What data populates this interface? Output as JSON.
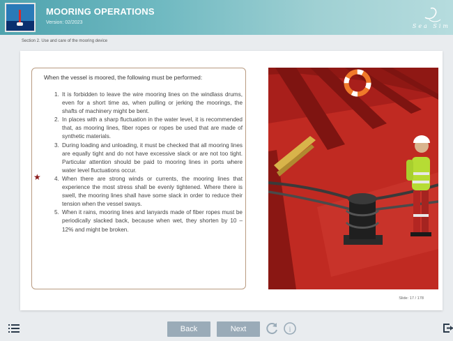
{
  "header": {
    "title": "MOORING OPERATIONS",
    "version": "Version: 02/2023",
    "brand": "Sea Sim"
  },
  "breadcrumb": "Section 2. Use and care of the mooring device",
  "content": {
    "intro": "When the vessel is moored, the following must be performed:",
    "rules": [
      {
        "num": "1.",
        "text": "It is forbidden to leave the wire mooring lines on the windlass drums, even for a short time as, when pulling or jerking the moorings, the shafts of machinery might be bent."
      },
      {
        "num": "2.",
        "text": "In places with a sharp fluctuation in the water level, it is recommended that, as mooring lines, fiber ropes or ropes be used that are made of synthetic materials."
      },
      {
        "num": "3.",
        "text": "During loading and unloading, it must be checked that all mooring lines are equally tight and do not have excessive slack or are not too tight. Particular attention should be paid to mooring lines in ports where water level fluctuations occur."
      },
      {
        "num": "4.",
        "text": "When there are strong winds or currents, the mooring lines that experience the most stress shall be evenly tightened. Where there is swell, the mooring lines shall have some slack in order to reduce their tension when the vessel sways."
      },
      {
        "num": "5.",
        "text": "When it rains, mooring lines and lanyards made of fiber ropes must be periodically slacked back, because when wet, they shorten by 10 – 12% and might be broken."
      }
    ],
    "star_glyph": "★"
  },
  "slide_counter": "Slide: 17 / 178",
  "footer": {
    "back_label": "Back",
    "next_label": "Next"
  },
  "icons": {
    "menu": "menu-icon",
    "reload": "reload-icon",
    "info": "info-icon",
    "exit": "exit-icon",
    "info_glyph": "i"
  },
  "colors": {
    "accent": "#9aabb8",
    "header": "#6fb9c1",
    "deck": "#b0231e",
    "star": "#8b1a1a"
  }
}
